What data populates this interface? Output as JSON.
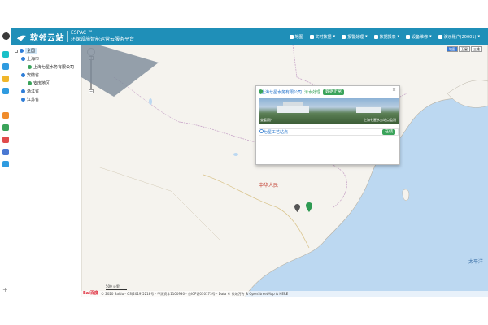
{
  "header": {
    "logo_text": "软邻云站",
    "brand_en": "ESPAC ™",
    "brand_cn": "环保设施智能运营云服务平台",
    "nav": [
      {
        "label": "地图",
        "icon": "map-icon"
      },
      {
        "label": "实时数据",
        "icon": "chart-icon"
      },
      {
        "label": "报警处理",
        "icon": "camera-icon"
      },
      {
        "label": "数据报表",
        "icon": "report-icon"
      },
      {
        "label": "设备维修",
        "icon": "wrench-icon"
      },
      {
        "label": "演示账户(20001)",
        "icon": "user-icon"
      }
    ]
  },
  "tree": {
    "nodes": [
      {
        "label": "全国"
      },
      {
        "label": "上海市"
      },
      {
        "label": "上海七星水务有限公司"
      },
      {
        "label": "安徽省"
      },
      {
        "label": "安庆地区"
      },
      {
        "label": "浙江省"
      },
      {
        "label": "江苏省"
      }
    ]
  },
  "map": {
    "labels": {
      "china": "中华人民",
      "pacific": "太平洋"
    },
    "map_types": [
      "地图",
      "卫星",
      "三维"
    ],
    "scale": "500 公里",
    "copyright": "© 2020 Baidu - GS(2019)5218号 - 甲测资字1100930 - 京ICP证030173号 - Data © 长地万方 & OpenStreetMap & HERE",
    "baidu_logo": "Bai百度"
  },
  "popup": {
    "company": "上海七星水务有限公司",
    "industry": "污水处理",
    "status_badge": "数据正常",
    "photo_caption_left": "查看照片",
    "photo_caption_right": "上海七星水务站点监测",
    "station_name": "七星工艺站点",
    "station_badge": "在线",
    "close": "×"
  },
  "colors": {
    "header_bg": "#1f8fb8",
    "accent_green": "#3aa35a",
    "accent_blue": "#1d6fc9",
    "sea": "#bcd8f1",
    "land": "#f5f3ee"
  }
}
